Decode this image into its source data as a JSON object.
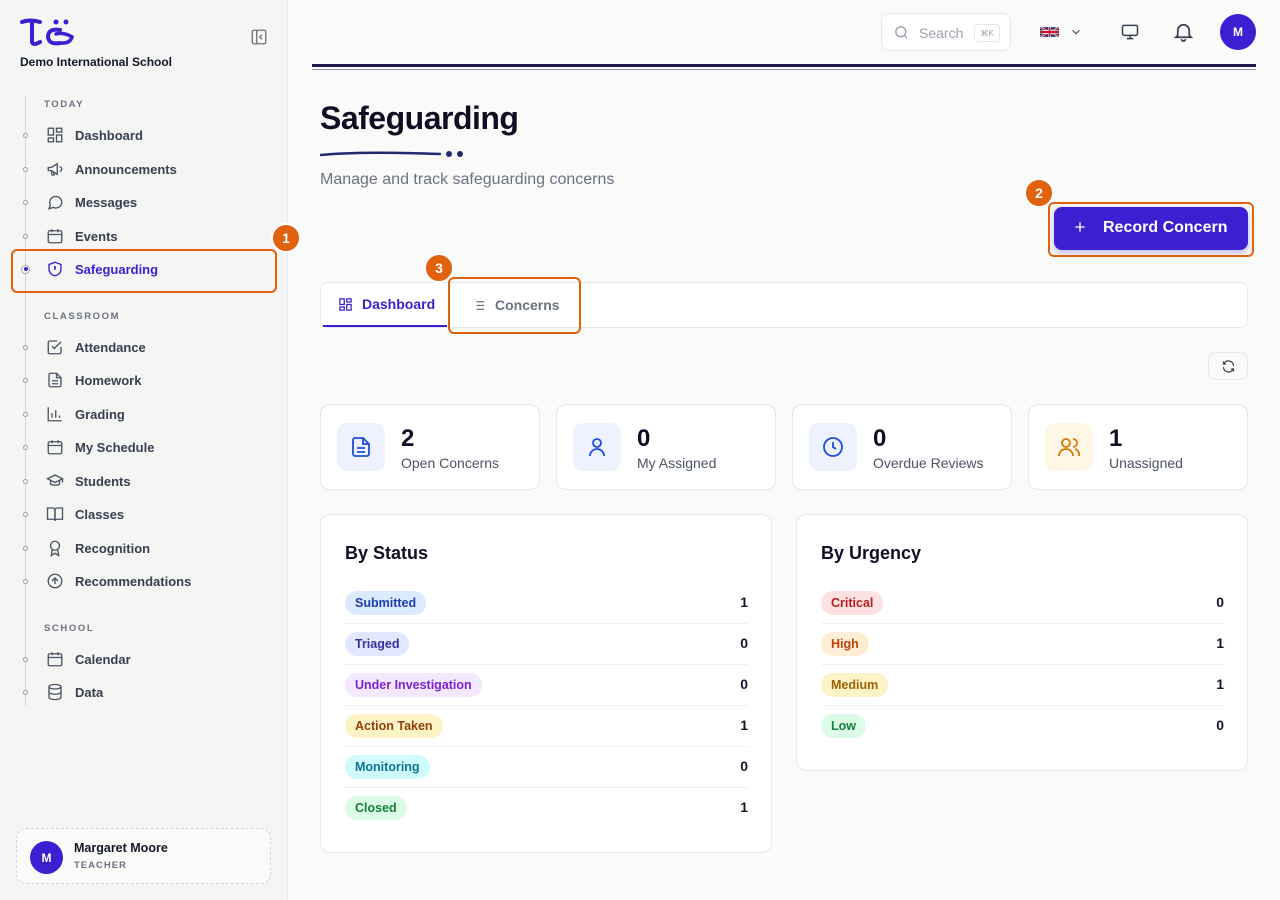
{
  "sidebar": {
    "school_name": "Demo International School",
    "sections": {
      "today": "TODAY",
      "classroom": "CLASSROOM",
      "school": "SCHOOL"
    },
    "today_items": [
      "Dashboard",
      "Announcements",
      "Messages",
      "Events",
      "Safeguarding"
    ],
    "classroom_items": [
      "Attendance",
      "Homework",
      "Grading",
      "My Schedule",
      "Students",
      "Classes",
      "Recognition",
      "Recommendations"
    ],
    "school_items": [
      "Calendar",
      "Data"
    ],
    "active_item": "Safeguarding",
    "user": {
      "initial": "M",
      "name": "Margaret Moore",
      "role": "TEACHER"
    }
  },
  "topbar": {
    "search_placeholder": "Search",
    "search_shortcut": "⌘K",
    "avatar_initial": "M"
  },
  "annotations": [
    "1",
    "2",
    "3"
  ],
  "page": {
    "title": "Safeguarding",
    "subtitle": "Manage and track safeguarding concerns",
    "record_button": "Record Concern",
    "tabs": [
      "Dashboard",
      "Concerns"
    ],
    "active_tab": "Dashboard"
  },
  "stats": [
    {
      "value": "2",
      "label": "Open Concerns",
      "icon": "document-icon"
    },
    {
      "value": "0",
      "label": "My Assigned",
      "icon": "user-icon"
    },
    {
      "value": "0",
      "label": "Overdue Reviews",
      "icon": "clock-icon"
    },
    {
      "value": "1",
      "label": "Unassigned",
      "icon": "users-icon"
    }
  ],
  "by_status": {
    "title": "By Status",
    "rows": [
      {
        "label": "Submitted",
        "count": "1"
      },
      {
        "label": "Triaged",
        "count": "0"
      },
      {
        "label": "Under Investigation",
        "count": "0"
      },
      {
        "label": "Action Taken",
        "count": "1"
      },
      {
        "label": "Monitoring",
        "count": "0"
      },
      {
        "label": "Closed",
        "count": "1"
      }
    ]
  },
  "by_urgency": {
    "title": "By Urgency",
    "rows": [
      {
        "label": "Critical",
        "count": "0"
      },
      {
        "label": "High",
        "count": "1"
      },
      {
        "label": "Medium",
        "count": "1"
      },
      {
        "label": "Low",
        "count": "0"
      }
    ]
  },
  "colors": {
    "accent": "#3b1fd1",
    "annotation": "#e0620e"
  }
}
